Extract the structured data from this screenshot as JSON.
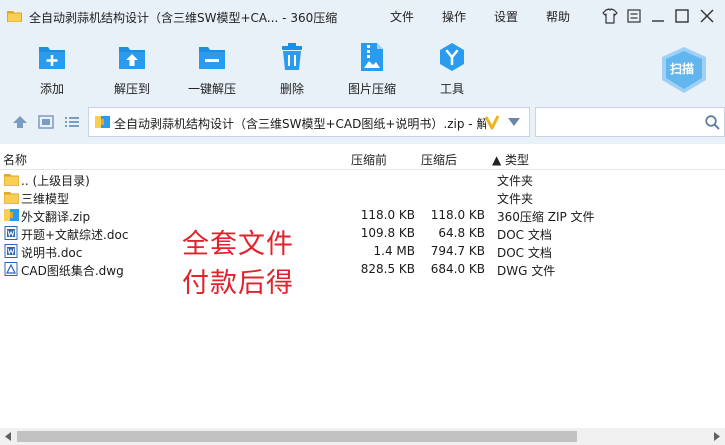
{
  "window": {
    "title": "全自动剥蒜机结构设计（含三维SW模型+CA... - 360压缩"
  },
  "menu": [
    "文件",
    "操作",
    "设置",
    "帮助"
  ],
  "toolbar": {
    "items": [
      {
        "label": "添加",
        "icon": "add-icon"
      },
      {
        "label": "解压到",
        "icon": "extract-to-icon"
      },
      {
        "label": "一键解压",
        "icon": "one-click-extract-icon"
      },
      {
        "label": "删除",
        "icon": "trash-icon"
      },
      {
        "label": "图片压缩",
        "icon": "image-compress-icon"
      },
      {
        "label": "工具",
        "icon": "tools-icon"
      }
    ],
    "scan_label": "扫描"
  },
  "address": {
    "path": "全自动剥蒜机结构设计（含三维SW模型+CAD图纸+说明书）.zip - 解"
  },
  "columns": {
    "name": "名称",
    "compressed": "压缩前",
    "uncompressed": "压缩后",
    "type": "▲ 类型"
  },
  "files": [
    {
      "name": ".. (上级目录)",
      "size_before": "",
      "size_after": "",
      "type": "文件夹",
      "icon": "folder-icon"
    },
    {
      "name": "三维模型",
      "size_before": "",
      "size_after": "",
      "type": "文件夹",
      "icon": "folder-icon"
    },
    {
      "name": "外文翻译.zip",
      "size_before": "118.0 KB",
      "size_after": "118.0 KB",
      "type": "360压缩 ZIP 文件",
      "icon": "zip-icon"
    },
    {
      "name": "开题+文献综述.doc",
      "size_before": "109.8 KB",
      "size_after": "64.8 KB",
      "type": "DOC 文档",
      "icon": "doc-icon"
    },
    {
      "name": "说明书.doc",
      "size_before": "1.4 MB",
      "size_after": "794.7 KB",
      "type": "DOC 文档",
      "icon": "doc-icon"
    },
    {
      "name": "CAD图纸集合.dwg",
      "size_before": "828.5 KB",
      "size_after": "684.0 KB",
      "type": "DWG 文件",
      "icon": "dwg-icon"
    }
  ],
  "overlay": {
    "line1": "全套文件",
    "line2": "付款后得"
  },
  "colors": {
    "accent": "#1e8fe0",
    "chrome": "#e8f0f8",
    "overlay_text": "#e2222c",
    "folder": "#f7cf52"
  }
}
